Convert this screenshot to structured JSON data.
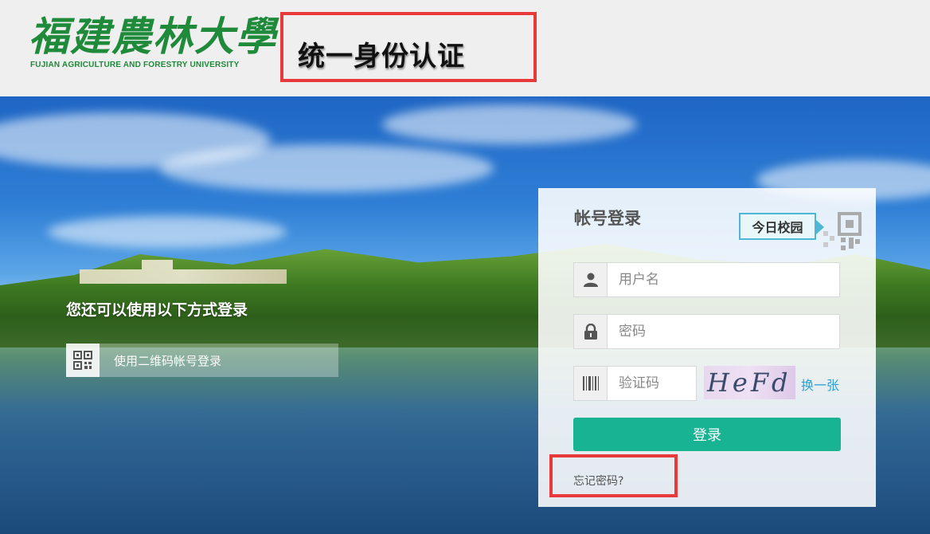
{
  "header": {
    "logo_cn": "福建農林大學",
    "logo_en": "FUJIAN AGRICULTURE AND FORESTRY UNIVERSITY",
    "title": "统一身份认证"
  },
  "alt_login": {
    "title": "您还可以使用以下方式登录",
    "qr_button_label": "使用二维码帐号登录"
  },
  "login": {
    "title": "帐号登录",
    "campus_tag": "今日校园",
    "username_placeholder": "用户名",
    "password_placeholder": "密码",
    "captcha_placeholder": "验证码",
    "captcha_text": "HeFd",
    "refresh_label": "换一张",
    "submit_label": "登录",
    "forgot_label": "忘记密码?"
  },
  "colors": {
    "brand_green": "#1f8a3a",
    "accent_teal": "#17b393",
    "link_blue": "#2b9fd6",
    "highlight_red": "#e83a3a"
  }
}
